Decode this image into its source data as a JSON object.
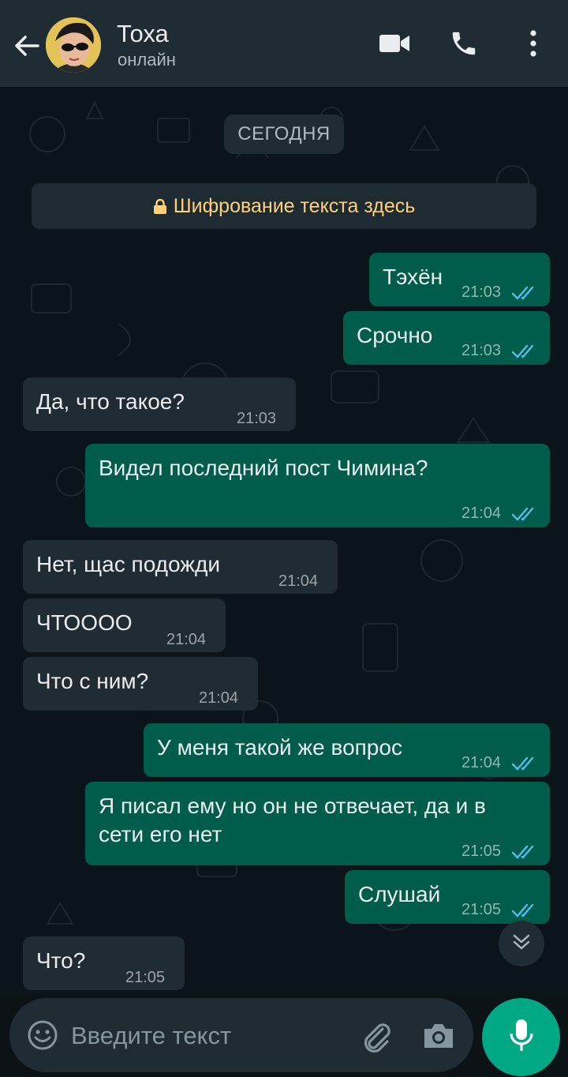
{
  "header": {
    "contact_name": "Тоха",
    "status": "онлайн",
    "icons": [
      "back-arrow-icon",
      "video-call-icon",
      "phone-icon",
      "more-vert-icon"
    ]
  },
  "chat": {
    "date_label": "СЕГОДНЯ",
    "encryption_notice": "Шифрование текста здесь",
    "messages": [
      {
        "direction": "out",
        "text": "Тэхён",
        "time": "21:03",
        "read": true
      },
      {
        "direction": "out",
        "text": "Срочно",
        "time": "21:03",
        "read": true
      },
      {
        "direction": "in",
        "text": "Да, что такое?",
        "time": "21:03"
      },
      {
        "direction": "out",
        "text": "Видел последний пост Чимина?",
        "time": "21:04",
        "read": true
      },
      {
        "direction": "in",
        "text": "Нет, щас подожди",
        "time": "21:04"
      },
      {
        "direction": "in",
        "text": "ЧТОООО",
        "time": "21:04"
      },
      {
        "direction": "in",
        "text": "Что с ним?",
        "time": "21:04"
      },
      {
        "direction": "out",
        "text": "У меня такой же вопрос",
        "time": "21:04",
        "read": true
      },
      {
        "direction": "out",
        "text": "Я писал ему но он не отвечает, да и в",
        "text_line2": "сети его нет",
        "time": "21:05",
        "read": true
      },
      {
        "direction": "out",
        "text": "Слушай",
        "time": "21:05",
        "read": true
      },
      {
        "direction": "in",
        "text": "Что?",
        "time": "21:05"
      }
    ]
  },
  "composer": {
    "placeholder": "Введите текст",
    "icons": [
      "emoji-icon",
      "attach-icon",
      "camera-icon",
      "mic-icon"
    ]
  },
  "colors": {
    "header_bg": "#1f2c34",
    "outgoing_bubble": "#005c4b",
    "incoming_bubble": "#1f2c34",
    "read_tick": "#53bdeb",
    "encryption_text": "#ffd279",
    "accent": "#00a884"
  }
}
